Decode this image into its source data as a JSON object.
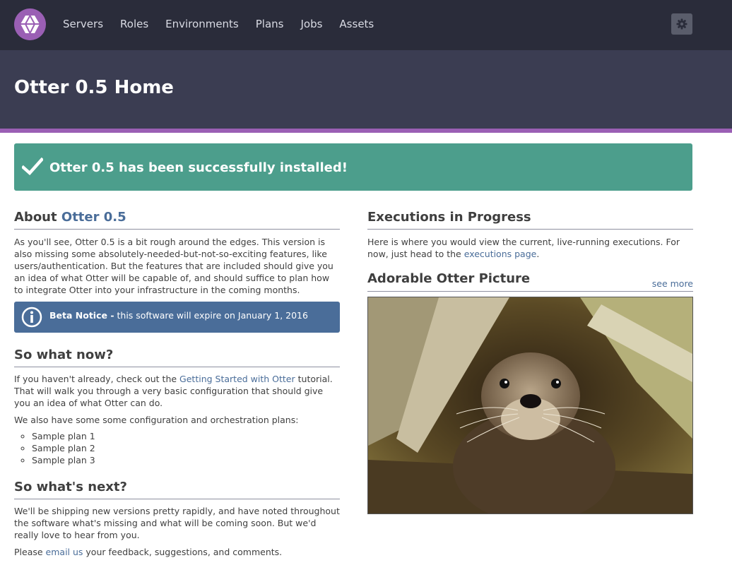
{
  "nav": {
    "logo_icon": "otter-hexagon-logo-icon",
    "links": [
      "Servers",
      "Roles",
      "Environments",
      "Plans",
      "Jobs",
      "Assets"
    ],
    "settings_icon": "gear-icon"
  },
  "header": {
    "title": "Otter 0.5 Home"
  },
  "success": {
    "icon": "checkmark-icon",
    "message": "Otter 0.5 has been successfully installed!"
  },
  "about": {
    "title_prefix": "About",
    "title_link": "Otter 0.5",
    "text": "As you'll see, Otter 0.5 is a bit rough around the edges. This version is also missing some absolutely-needed-but-not-so-exciting features, like users/authentication. But the features that are included should give you an idea of what Otter will be capable of, and should suffice to plan how to integrate Otter into your infrastructure in the coming months."
  },
  "beta": {
    "icon": "info-circle-icon",
    "label": "Beta Notice -",
    "text": " this software will expire on January 1, 2016"
  },
  "so_what_now": {
    "title": "So what now?",
    "p1_before": "If you haven't already, check out the ",
    "p1_link": "Getting Started with Otter",
    "p1_after": " tutorial. That will walk you through a very basic configuration that should give you an idea of what Otter can do.",
    "p2": "We also have some some configuration and orchestration plans:",
    "plans": [
      "Sample plan 1",
      "Sample plan 2",
      "Sample plan 3"
    ]
  },
  "whats_next": {
    "title": "So what's next?",
    "p1": "We'll be shipping new versions pretty rapidly, and have noted throughout the software what's missing and what will be coming soon. But we'd really love to hear from you.",
    "p2_before": "Please ",
    "p2_link": "email us",
    "p2_after": " your feedback, suggestions, and comments."
  },
  "executions": {
    "title": "Executions in Progress",
    "text_before": "Here is where you would view the current, live-running executions. For now, just head to the ",
    "link": "executions page",
    "text_after": "."
  },
  "picture": {
    "title": "Adorable Otter Picture",
    "see_more": "see more",
    "image_icon": "otter-photo"
  },
  "colors": {
    "nav_bg": "#2a2c3a",
    "header_bg": "#3b3d52",
    "brand_purple": "#9a5fb4",
    "success_green": "#4c9e8c",
    "info_blue": "#4a6d99",
    "link": "#4a6d99"
  }
}
